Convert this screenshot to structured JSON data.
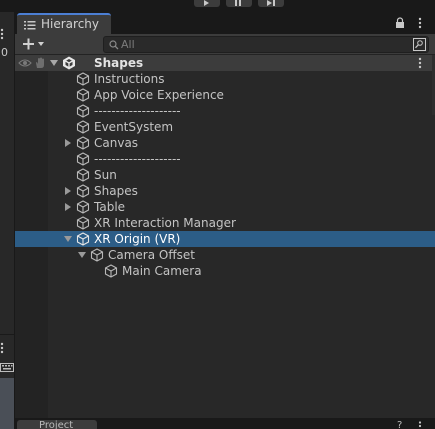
{
  "toolbar_top": {
    "controls": [
      "play-icon",
      "pause-icon",
      "step-icon"
    ]
  },
  "left_panel": {
    "value": "0"
  },
  "hierarchy": {
    "tab_label": "Hierarchy",
    "tab_icon": "list-icon",
    "search_placeholder": "All",
    "scene": {
      "name": "Shapes",
      "icon": "unity-icon"
    },
    "items": [
      {
        "label": "Instructions",
        "depth": 1,
        "expandable": false,
        "selected": false
      },
      {
        "label": "App Voice Experience",
        "depth": 1,
        "expandable": false,
        "selected": false
      },
      {
        "label": "--------------------",
        "depth": 1,
        "expandable": false,
        "selected": false
      },
      {
        "label": "EventSystem",
        "depth": 1,
        "expandable": false,
        "selected": false
      },
      {
        "label": "Canvas",
        "depth": 1,
        "expandable": true,
        "expanded": false,
        "selected": false
      },
      {
        "label": "--------------------",
        "depth": 1,
        "expandable": false,
        "selected": false
      },
      {
        "label": "Sun",
        "depth": 1,
        "expandable": false,
        "selected": false
      },
      {
        "label": "Shapes",
        "depth": 1,
        "expandable": true,
        "expanded": false,
        "selected": false
      },
      {
        "label": "Table",
        "depth": 1,
        "expandable": true,
        "expanded": false,
        "selected": false
      },
      {
        "label": "XR Interaction Manager",
        "depth": 1,
        "expandable": false,
        "selected": false
      },
      {
        "label": "XR Origin (VR)",
        "depth": 1,
        "expandable": true,
        "expanded": true,
        "selected": true
      },
      {
        "label": "Camera Offset",
        "depth": 2,
        "expandable": true,
        "expanded": true,
        "selected": false
      },
      {
        "label": "Main Camera",
        "depth": 3,
        "expandable": false,
        "selected": false
      }
    ]
  },
  "bottom_tab": {
    "label": "Project",
    "help": "?"
  },
  "colors": {
    "selection": "#2c5d87",
    "panel_bg": "#282828",
    "toolbar_bg": "#3c3c3c",
    "accent": "#4c7fd4"
  }
}
